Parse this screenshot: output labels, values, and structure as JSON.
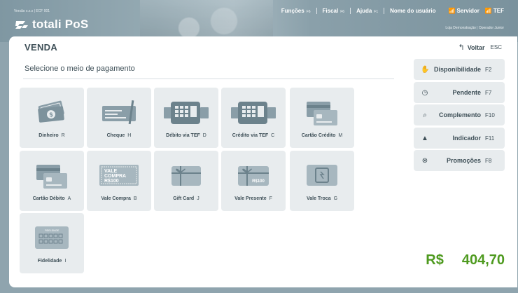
{
  "header": {
    "version": "Versão x.x.x | ECF 001",
    "brand": "totali PoS",
    "menu": [
      {
        "label": "Funções",
        "key": "F6"
      },
      {
        "label": "Fiscal",
        "key": "F6"
      },
      {
        "label": "Ajuda",
        "key": "F1"
      },
      {
        "label": "Nome do usuário",
        "key": ""
      }
    ],
    "status": [
      {
        "label": "Servidor",
        "icon": "wifi-icon"
      },
      {
        "label": "TEF",
        "icon": "wifi-icon"
      }
    ],
    "store_info": "Loja Demonstração | Operador Junior"
  },
  "page": {
    "title": "VENDA",
    "back_label": "Voltar",
    "back_key": "ESC",
    "subtitle": "Selecione o meio de pagamento"
  },
  "payment_methods": [
    {
      "label": "Dinheiro",
      "key": "R",
      "icon": "cash-icon"
    },
    {
      "label": "Cheque",
      "key": "H",
      "icon": "check-icon"
    },
    {
      "label": "Débito via TEF",
      "key": "D",
      "icon": "card-terminal-icon"
    },
    {
      "label": "Crédito via TEF",
      "key": "C",
      "icon": "card-terminal-icon"
    },
    {
      "label": "Cartão Crédito",
      "key": "M",
      "icon": "credit-card-icon"
    },
    {
      "label": "Cartão Débito",
      "key": "A",
      "icon": "debit-card-icon"
    },
    {
      "label": "Vale Compra",
      "key": "B",
      "icon": "voucher-icon",
      "icon_text": [
        "VALE",
        "COMPRA",
        "R$100"
      ]
    },
    {
      "label": "Gift Card",
      "key": "J",
      "icon": "gift-card-icon"
    },
    {
      "label": "Vale Presente",
      "key": "F",
      "icon": "gift-voucher-icon",
      "icon_text": "R$100"
    },
    {
      "label": "Vale Troca",
      "key": "G",
      "icon": "exchange-voucher-icon"
    },
    {
      "label": "Fidelidade",
      "key": "I",
      "icon": "loyalty-card-icon",
      "icon_text": "FIDELIDADE"
    }
  ],
  "side_actions": [
    {
      "label": "Disponibilidade",
      "key": "F2",
      "icon": "hand-icon"
    },
    {
      "label": "Pendente",
      "key": "F7",
      "icon": "clock-icon"
    },
    {
      "label": "Complemento",
      "key": "F10",
      "icon": "search-icon"
    },
    {
      "label": "Indicador",
      "key": "F11",
      "icon": "user-icon"
    },
    {
      "label": "Promoções",
      "key": "F8",
      "icon": "percent-icon"
    }
  ],
  "total": {
    "currency": "R$",
    "value": "404,70"
  },
  "colors": {
    "header_bg": "#8fa4ae",
    "text": "#3e4f57",
    "tile_bg": "#e8ecee",
    "icon": "#8a9ea8",
    "total": "#4e9a1f"
  }
}
